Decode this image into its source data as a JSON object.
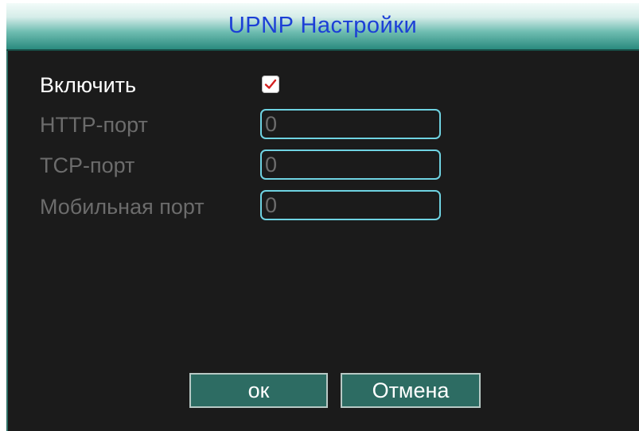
{
  "dialog": {
    "title": "UPNP Настройки"
  },
  "form": {
    "enable": {
      "label": "Включить",
      "checked": true
    },
    "http_port": {
      "label": "HTTP-порт",
      "value": "0"
    },
    "tcp_port": {
      "label": "TCP-порт",
      "value": "0"
    },
    "mobile_port": {
      "label": "Мобильная порт",
      "value": "0"
    }
  },
  "buttons": {
    "ok_label": "ок",
    "cancel_label": "Отмена"
  },
  "colors": {
    "title_text": "#1c3fd6",
    "field_border": "#6fd3e2",
    "checkmark": "#d42020",
    "button_bg": "#2d6c63",
    "disabled_text": "#6c6c6c"
  }
}
